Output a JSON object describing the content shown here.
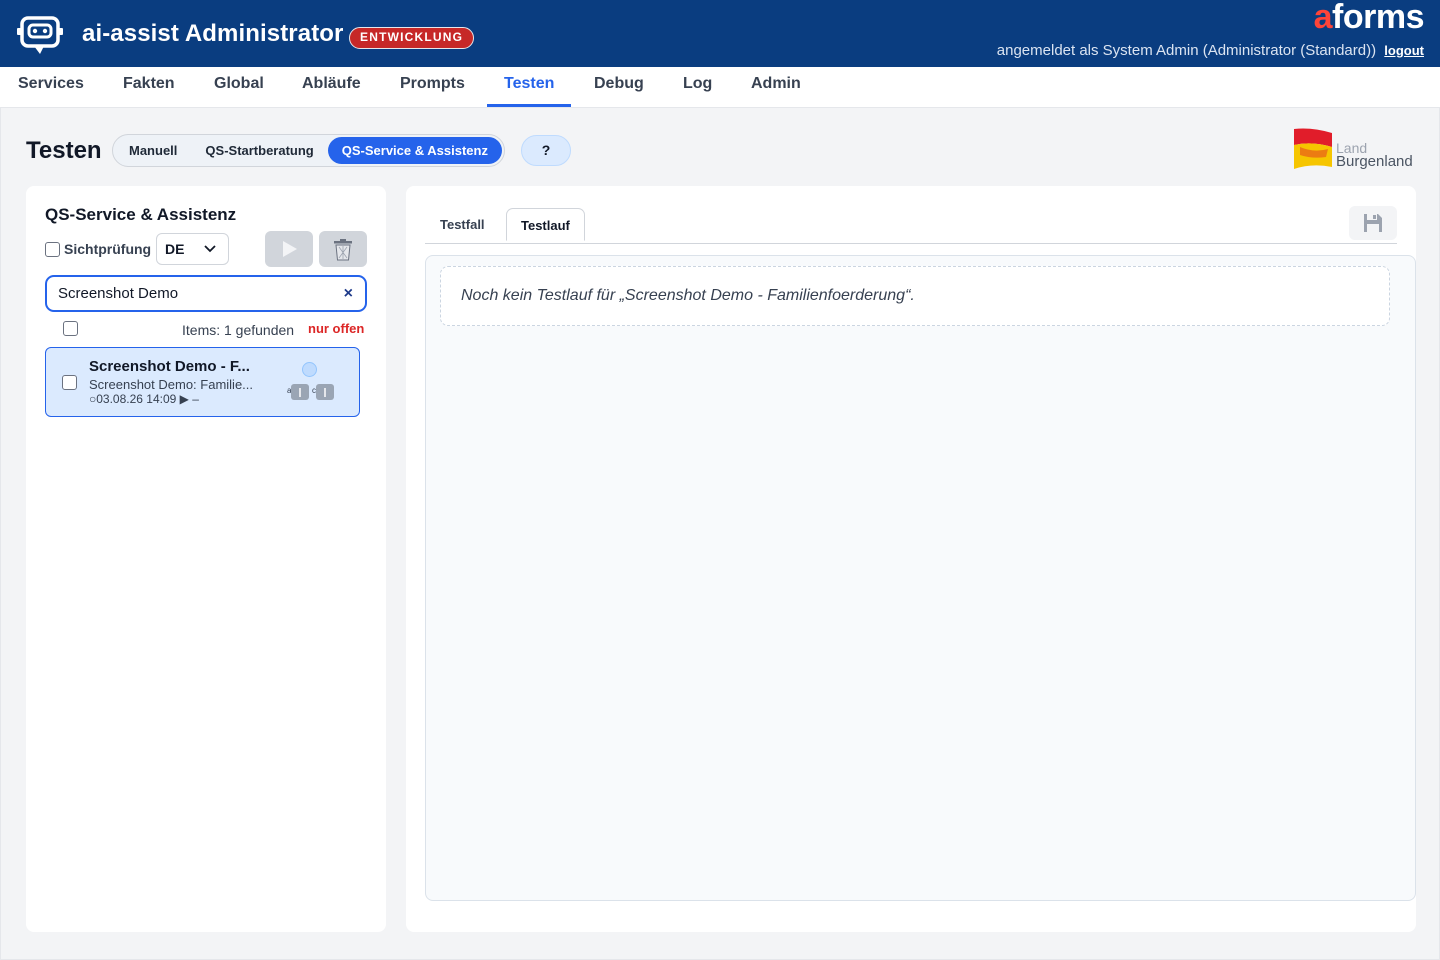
{
  "header": {
    "app_title": "ai-assist Administrator",
    "env_badge": "ENTWICKLUNG",
    "brand_a": "a",
    "brand_rest": "forms",
    "user_text": "angemeldet als System Admin (Administrator (Standard))",
    "logout_label": "logout",
    "colors": {
      "bg": "#0a3d80",
      "badge": "#c62828",
      "brand_accent": "#ff4438"
    }
  },
  "nav": {
    "items": [
      {
        "label": "Services"
      },
      {
        "label": "Fakten"
      },
      {
        "label": "Global"
      },
      {
        "label": "Abläufe"
      },
      {
        "label": "Prompts"
      },
      {
        "label": "Testen",
        "active": true
      },
      {
        "label": "Debug"
      },
      {
        "label": "Log"
      },
      {
        "label": "Admin"
      }
    ],
    "active_color": "#2563eb"
  },
  "page": {
    "title": "Testen",
    "modes": [
      {
        "label": "Manuell"
      },
      {
        "label": "QS-Startberatung"
      },
      {
        "label": "QS-Service & Assistenz",
        "active": true
      }
    ],
    "help_label": "?",
    "land_logo": {
      "line1": "Land",
      "line2": "Burgenland"
    }
  },
  "left": {
    "title": "QS-Service & Assistenz",
    "visual_check_label": "Sichtprüfung",
    "language": "DE",
    "search_value": "Screenshot Demo",
    "clear_symbol": "×",
    "items_count": "Items: 1 gefunden",
    "only_open": "nur offen",
    "list": [
      {
        "title": "Screenshot Demo - F...",
        "subtitle": "Screenshot Demo: Familie...",
        "meta": "○03.08.26 14:09  ▶ –",
        "mini_a": "a",
        "mini_c": "c"
      }
    ]
  },
  "right": {
    "tabs": [
      {
        "label": "Testfall"
      },
      {
        "label": "Testlauf",
        "active": true
      }
    ],
    "empty_message": "Noch kein Testlauf für „Screenshot Demo - Familienfoerderung“."
  }
}
